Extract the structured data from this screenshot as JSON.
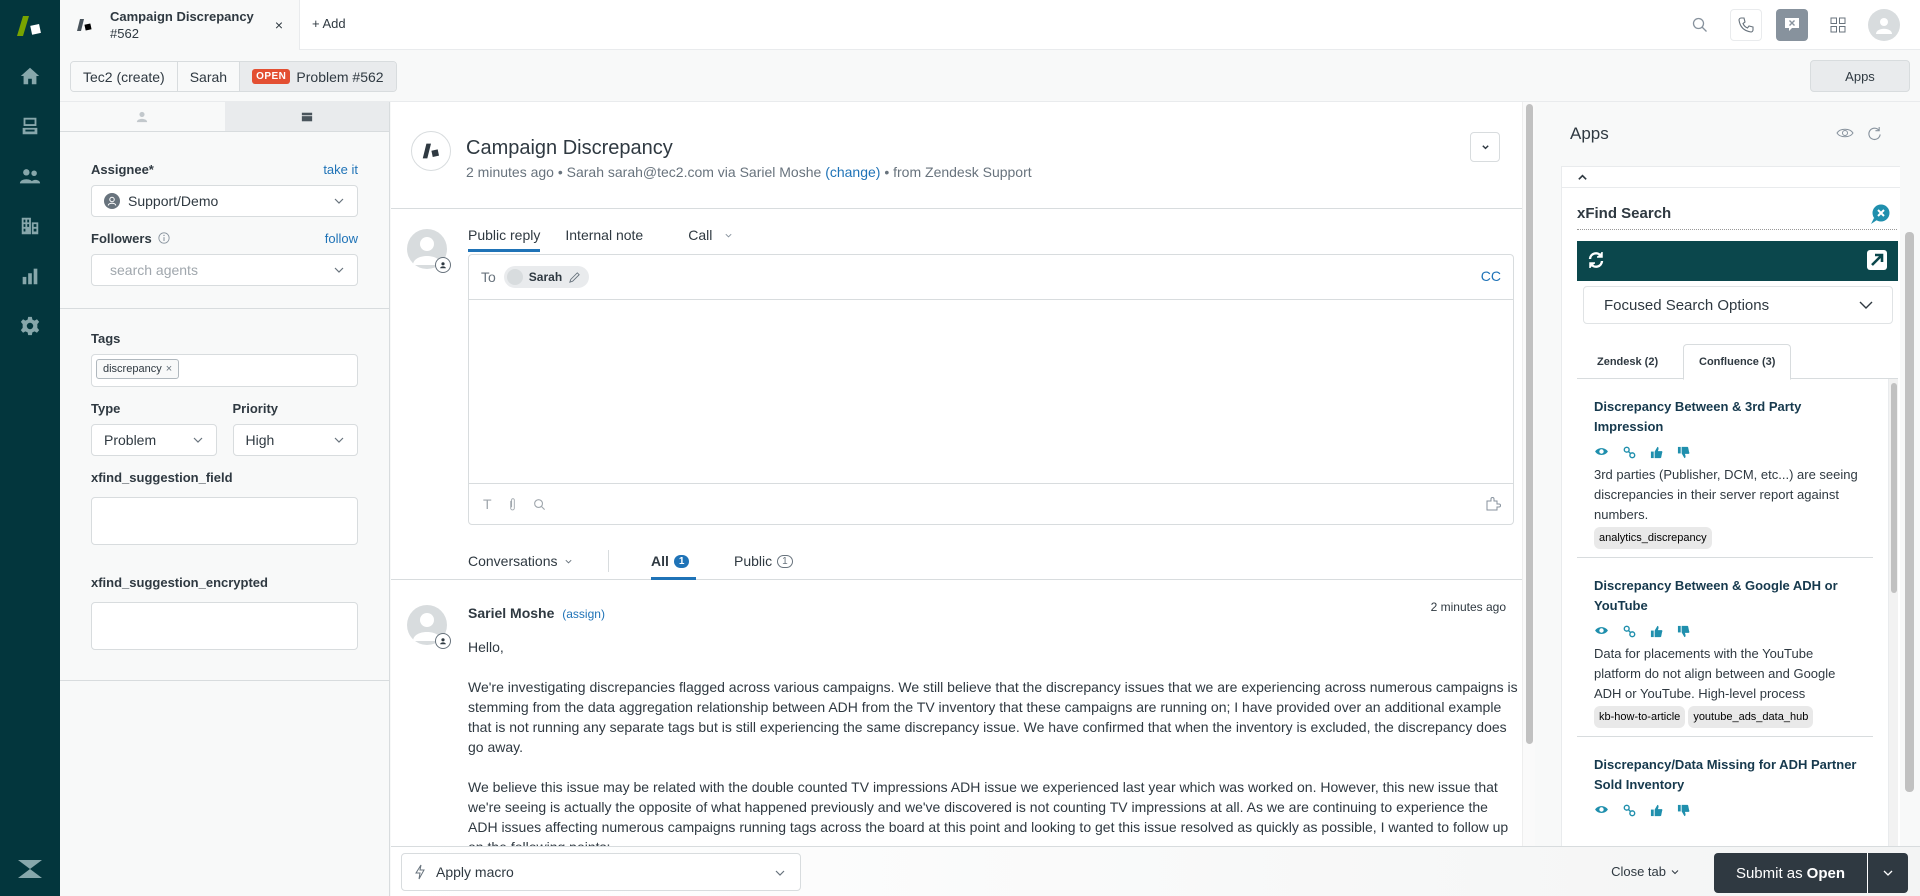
{
  "nav": {
    "items": [
      {
        "name": "home",
        "label": "Home"
      },
      {
        "name": "views",
        "label": "Views"
      },
      {
        "name": "customers",
        "label": "Customers"
      },
      {
        "name": "organizations",
        "label": "Organizations"
      },
      {
        "name": "reporting",
        "label": "Reporting"
      },
      {
        "name": "admin",
        "label": "Admin"
      }
    ]
  },
  "topbar": {
    "tab_title": "Campaign Discrepancy",
    "tab_subtitle": "#562",
    "close_glyph": "×",
    "add_label": "+ Add"
  },
  "breadcrumb": {
    "items": [
      "Tec2 (create)",
      "Sarah"
    ],
    "status_badge": "OPEN",
    "ticket_label": "Problem #562",
    "apps_button": "Apps"
  },
  "properties": {
    "assignee_label": "Assignee*",
    "take_it": "take it",
    "assignee_value": "Support/Demo",
    "followers_label": "Followers",
    "follow": "follow",
    "followers_placeholder": "search agents",
    "tags_label": "Tags",
    "tags": [
      "discrepancy"
    ],
    "type_label": "Type",
    "type_value": "Problem",
    "priority_label": "Priority",
    "priority_value": "High",
    "field1_label": "xfind_suggestion_field",
    "field2_label": "xfind_suggestion_encrypted"
  },
  "ticket": {
    "title": "Campaign Discrepancy",
    "meta_prefix": "2 minutes ago • Sarah   sarah@tec2.com via Sariel Moshe",
    "meta_change": "(change)",
    "meta_suffix": "• from Zendesk Support"
  },
  "composer": {
    "tabs": [
      "Public reply",
      "Internal note",
      "Call"
    ],
    "active_tab": "Public reply",
    "to_label": "To",
    "recipient": "Sarah",
    "cc_label": "CC"
  },
  "conversations": {
    "filter_label": "Conversations",
    "all_label": "All",
    "all_count": "1",
    "public_label": "Public",
    "public_count": "1"
  },
  "comment": {
    "author": "Sariel Moshe",
    "assign_link": "(assign)",
    "time": "2 minutes ago",
    "paragraphs": [
      "Hello,",
      "We're investigating discrepancies flagged across various campaigns. We still believe that the discrepancy issues that we are experiencing across numerous campaigns is stemming from the data aggregation relationship between ADH from the TV inventory that these campaigns are running on; I have provided over an additional example that is not running any separate tags but is still experiencing the same discrepancy issue. We have confirmed that when the inventory is excluded, the discrepancy does go away.",
      "We believe this issue may be related with the double counted TV impressions ADH issue we experienced last year which was worked on. However, this new issue that we're seeing is actually the opposite of what happened previously and we've discovered is not counting TV impressions at all. As we are continuing to experience the ADH issues affecting numerous campaigns running tags across the board at this point and looking to get this issue resolved as quickly as possible, I wanted to follow up on the following points:"
    ]
  },
  "footer": {
    "macro_label": "Apply macro",
    "close_tab": "Close tab",
    "submit_prefix": "Submit as",
    "submit_status": "Open"
  },
  "apps_panel": {
    "title": "Apps",
    "app_name": "xFind Search",
    "focused_options": "Focused Search Options",
    "tabs": [
      {
        "label": "Zendesk (2)",
        "active": false
      },
      {
        "label": "Confluence (3)",
        "active": true
      }
    ],
    "results": [
      {
        "title": "Discrepancy Between & 3rd Party Impression",
        "description": "3rd parties (Publisher, DCM, etc...) are seeing discrepancies in their server report against numbers.",
        "tags": [
          "analytics_discrepancy"
        ]
      },
      {
        "title": "Discrepancy Between & Google ADH or YouTube",
        "description": "Data for placements with the YouTube platform do not align between and Google ADH or YouTube. High-level process",
        "tags": [
          "kb-how-to-article",
          "youtube_ads_data_hub"
        ]
      },
      {
        "title": "Discrepancy/Data Missing for ADH Partner Sold Inventory",
        "description": "",
        "tags": []
      }
    ]
  },
  "colors": {
    "nav_bg": "#03363d",
    "accent_blue": "#1f73b7",
    "open_badge": "#e34f32",
    "xfind_bar": "#0b474c",
    "xfind_icon": "#1f8fad",
    "submit_bg": "#2f3941"
  }
}
